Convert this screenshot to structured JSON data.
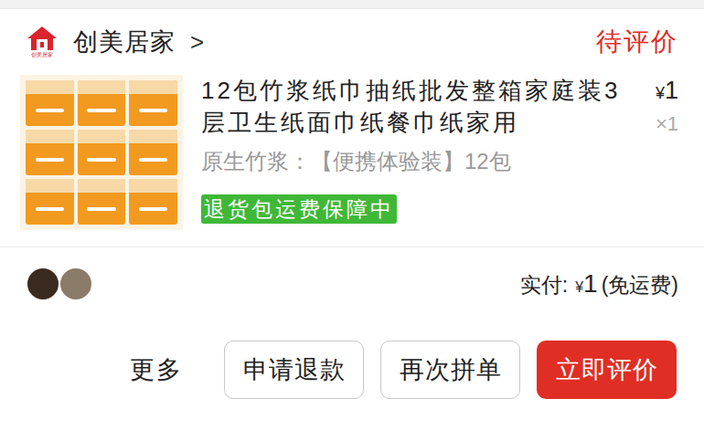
{
  "store": {
    "logo_text": "创美居家",
    "name": "创美居家",
    "chevron": ">"
  },
  "order_status": "待评价",
  "product": {
    "title": "12包竹浆纸巾抽纸批发整箱家庭装3层卫生纸面巾纸餐巾纸家用",
    "currency": "¥",
    "price": "1",
    "quantity": "×1",
    "spec": "原生竹浆：【便携体验装】12包",
    "badge": "退货包运费保障中"
  },
  "group_avatars": [
    {
      "color": "#3a2a20"
    },
    {
      "color": "#8a7a68"
    }
  ],
  "payment": {
    "label": "实付:",
    "currency": "¥",
    "amount": "1",
    "note": "(免运费)"
  },
  "actions": [
    {
      "label": "更多",
      "kind": "link"
    },
    {
      "label": "申请退款",
      "kind": "outline"
    },
    {
      "label": "再次拼单",
      "kind": "outline"
    },
    {
      "label": "立即评价",
      "kind": "primary"
    }
  ]
}
